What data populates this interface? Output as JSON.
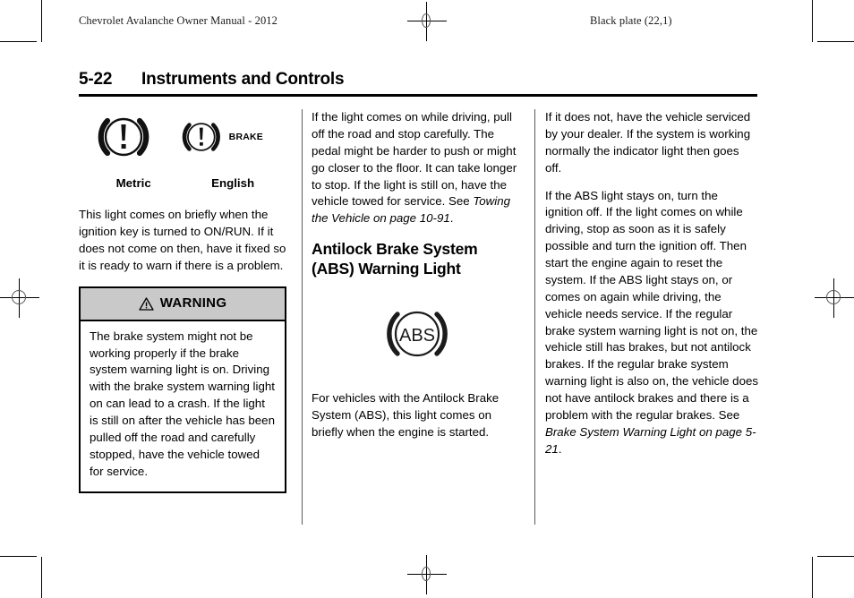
{
  "page": {
    "running_head_left": "Chevrolet Avalanche Owner Manual - 2012",
    "running_head_right": "Black plate (22,1)",
    "folio": "5-22",
    "title": "Instruments and Controls"
  },
  "column_left": {
    "symbols": {
      "metric_icon": "brake-warning-telltale-icon",
      "english_icon": "brake-warning-telltale-icon",
      "brake_text": "BRAKE",
      "caption_metric": "Metric",
      "caption_english": "English"
    },
    "paragraph_1": "This light comes on briefly when the ignition key is turned to ON/RUN. If it does not come on then, have it fixed so it is ready to warn if there is a problem.",
    "warning": {
      "icon": "warning-triangle-icon",
      "heading": "WARNING",
      "body": "The brake system might not be working properly if the brake system warning light is on. Driving with the brake system warning light on can lead to a crash. If the light is still on after the vehicle has been pulled off the road and carefully stopped, have the vehicle towed for service."
    }
  },
  "column_middle": {
    "paragraph_1_lead": "If the light comes on while driving, pull off the road and stop carefully. The pedal might be harder to push or might go closer to the floor. It can take longer to stop. If the light is still on, have the vehicle towed for service. See ",
    "paragraph_1_xref": "Towing the Vehicle on page 10-91",
    "paragraph_1_tail": ".",
    "section_heading": "Antilock Brake System (ABS) Warning Light",
    "abs_icon": "abs-warning-telltale-icon",
    "abs_icon_text": "ABS",
    "paragraph_2": "For vehicles with the Antilock Brake System (ABS), this light comes on briefly when the engine is started."
  },
  "column_right": {
    "paragraph_1": "If it does not, have the vehicle serviced by your dealer. If the system is working normally the indicator light then goes off.",
    "paragraph_2_lead": "If the ABS light stays on, turn the ignition off. If the light comes on while driving, stop as soon as it is safely possible and turn the ignition off. Then start the engine again to reset the system. If the ABS light stays on, or comes on again while driving, the vehicle needs service. If the regular brake system warning light is not on, the vehicle still has brakes, but not antilock brakes. If the regular brake system warning light is also on, the vehicle does not have antilock brakes and there is a problem with the regular brakes. See ",
    "paragraph_2_xref": "Brake System Warning Light on page 5-21",
    "paragraph_2_tail": "."
  },
  "colors": {
    "ink": "#000000",
    "warning_header_bg": "#c9c9c9",
    "rule": "#5a5a5a"
  }
}
